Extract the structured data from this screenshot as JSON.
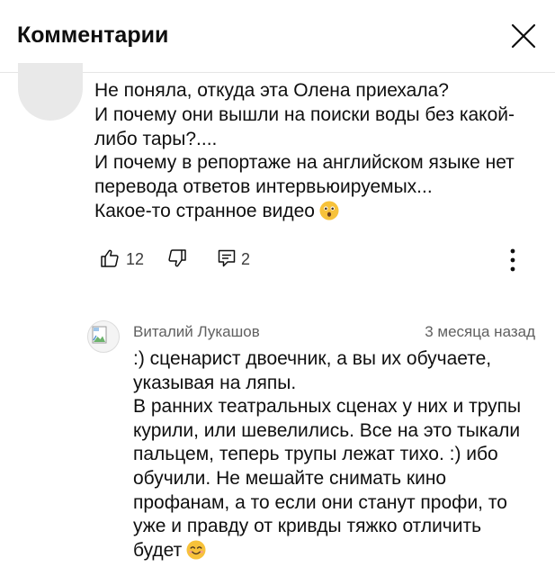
{
  "header": {
    "title": "Комментарии",
    "close_icon": "close-icon"
  },
  "comment": {
    "avatar_icon": "avatar",
    "lines": [
      "Не поняла, откуда эта Олена приехала?",
      "И почему они вышли на поиски воды без какой-",
      "либо тары?....",
      "И почему в репортаже на английском языке нет",
      "перевода ответов интервьюируемых...",
      "Какое-то странное видео"
    ],
    "end_emoji": "astonished-face-emoji",
    "likes": "12",
    "replies": "2",
    "icons": {
      "like": "thumbs-up-icon",
      "dislike": "thumbs-down-icon",
      "reply": "reply-icon",
      "more": "more-vertical-icon"
    }
  },
  "reply": {
    "author": "Виталий Лукашов",
    "time": "3 месяца назад",
    "avatar_icon": "broken-image-icon",
    "lines": [
      ":) сценарист двоечник, а вы их обучаете,",
      "указывая на ляпы.",
      "В ранних театральных сценах у них и трупы",
      "курили, или шевелились. Все на это тыкали",
      "пальцем, теперь трупы лежат тихо. :) ибо",
      "обучили. Не мешайте снимать кино",
      "профанам, а то если они станут профи, то",
      "уже и правду от кривды тяжко отличить",
      "будет"
    ],
    "end_emoji": "smiling-face-emoji"
  },
  "colors": {
    "text_primary": "#0f0f0f",
    "text_secondary": "#606060",
    "divider": "#e5e5e5",
    "emoji_yellow": "#f7c23a"
  }
}
